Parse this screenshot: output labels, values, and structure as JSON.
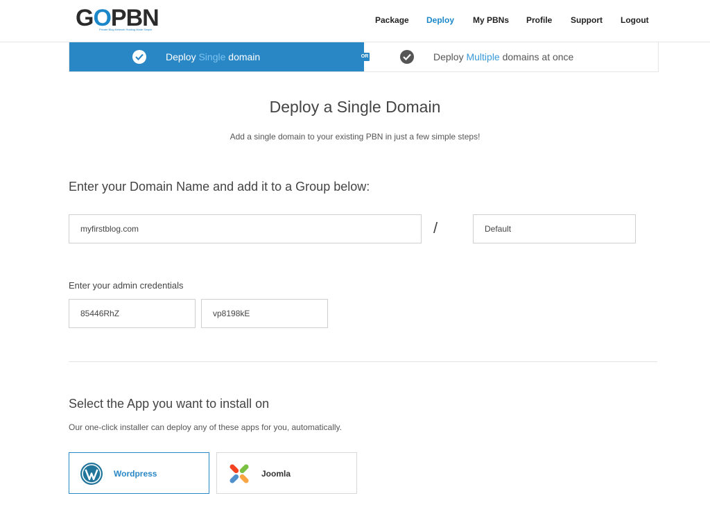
{
  "brand": {
    "logo_text_pre": "G",
    "logo_text_o": "O",
    "logo_text_post": "PBN",
    "tagline": "Private Blog Network Hosting Made Simple"
  },
  "nav": {
    "package": "Package",
    "deploy": "Deploy",
    "my_pbns": "My PBNs",
    "profile": "Profile",
    "support": "Support",
    "logout": "Logout",
    "active": "Deploy"
  },
  "tabs": {
    "single": {
      "pre": "Deploy ",
      "hl": "Single",
      "post": " domain"
    },
    "or": "OR",
    "multiple": {
      "pre": "Deploy ",
      "hl": "Multiple",
      "post": " domains at once"
    }
  },
  "page": {
    "title": "Deploy a Single Domain",
    "subtitle": "Add a single domain to your existing PBN in just a few simple steps!"
  },
  "domain_section": {
    "title": "Enter your Domain Name and add it to a Group below:",
    "domain_value": "myfirstblog.com",
    "separator": "/",
    "group_value": "Default"
  },
  "credentials": {
    "label": "Enter your admin credentials",
    "username": "85446RhZ",
    "password": "vp8198kE"
  },
  "apps": {
    "title": "Select the App you want to install on",
    "description": "Our one-click installer can deploy any of these apps for you, automatically.",
    "items": [
      {
        "label": "Wordpress",
        "icon": "wordpress-icon",
        "selected": true
      },
      {
        "label": "Joomla",
        "icon": "joomla-icon",
        "selected": false
      }
    ]
  },
  "colors": {
    "accent": "#2a87c6",
    "text": "#444444",
    "border": "#cfcfcf"
  }
}
